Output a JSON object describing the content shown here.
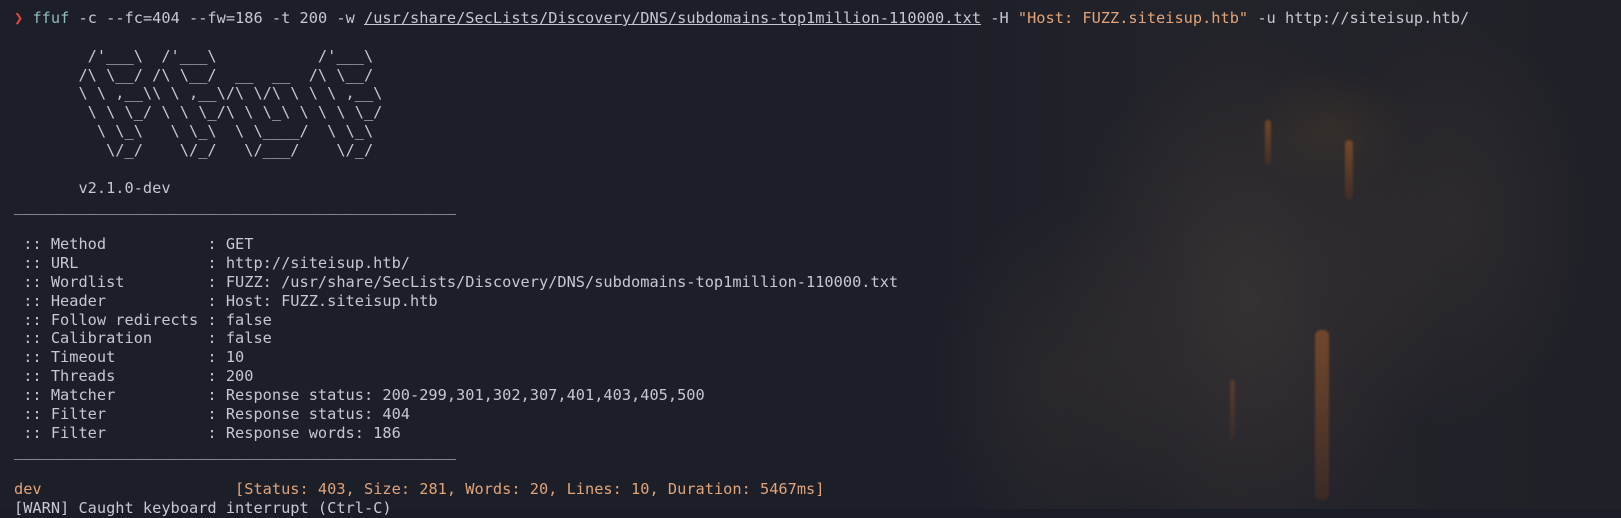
{
  "command": {
    "prompt_symbol": "❯",
    "program": "ffuf",
    "args1": " -c --fc=404 --fw=186 -t 200 -w ",
    "wordlist_path": "/usr/share/SecLists/Discovery/DNS/subdomains-top1million-110000.txt",
    "args2": " -H ",
    "header_string": "\"Host: FUZZ.siteisup.htb\"",
    "args3": " -u http://siteisup.htb/"
  },
  "banner": [
    "",
    "        /'___\\  /'___\\           /'___\\",
    "       /\\ \\__/ /\\ \\__/  __  __  /\\ \\__/",
    "       \\ \\ ,__\\\\ \\ ,__\\/\\ \\/\\ \\ \\ \\ ,__\\",
    "        \\ \\ \\_/ \\ \\ \\_/\\ \\ \\_\\ \\ \\ \\ \\_/",
    "         \\ \\_\\   \\ \\_\\  \\ \\____/  \\ \\_\\",
    "          \\/_/    \\/_/   \\/___/    \\/_/",
    "",
    "       v2.1.0-dev",
    "________________________________________________",
    ""
  ],
  "config": [
    " :: Method           : GET",
    " :: URL              : http://siteisup.htb/",
    " :: Wordlist         : FUZZ: /usr/share/SecLists/Discovery/DNS/subdomains-top1million-110000.txt",
    " :: Header           : Host: FUZZ.siteisup.htb",
    " :: Follow redirects : false",
    " :: Calibration      : false",
    " :: Timeout          : 10",
    " :: Threads          : 200",
    " :: Matcher          : Response status: 200-299,301,302,307,401,403,405,500",
    " :: Filter           : Response status: 404",
    " :: Filter           : Response words: 186",
    "________________________________________________",
    ""
  ],
  "result": {
    "word": "dev",
    "pad": "                     ",
    "meta": "[Status: 403, Size: 281, Words: 20, Lines: 10, Duration: 5467ms]"
  },
  "partial_line": "[WARN] Caught keyboard interrupt (Ctrl-C)"
}
